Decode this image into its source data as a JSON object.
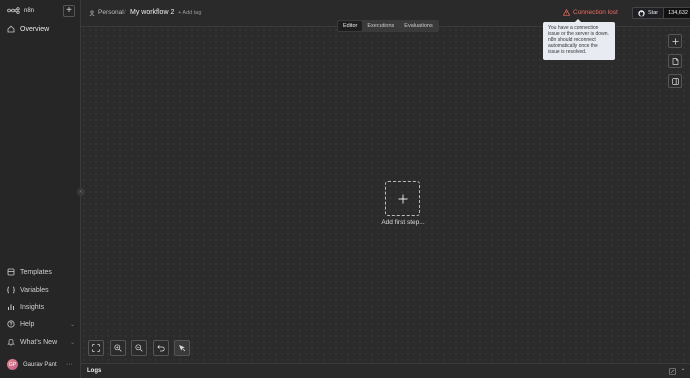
{
  "sidebar": {
    "logo_text": "n8n",
    "new_button": "+",
    "items": [
      {
        "label": "Overview",
        "icon": "home-icon"
      },
      {
        "label": "Templates",
        "icon": "templates-icon"
      },
      {
        "label": "Variables",
        "icon": "variables-icon"
      },
      {
        "label": "Insights",
        "icon": "insights-icon"
      },
      {
        "label": "Help",
        "icon": "help-icon"
      },
      {
        "label": "What's New",
        "icon": "bell-icon"
      }
    ],
    "user": {
      "initials": "GP",
      "name": "Gaurav Pant",
      "menu": "···"
    }
  },
  "header": {
    "project": "Personal",
    "separator": "/",
    "workflow_name": "My workflow 2",
    "add_tag": "+ Add tag",
    "connection_status": "Connection lost",
    "star_label": "Star",
    "star_count": "134,632"
  },
  "tabs": [
    {
      "label": "Editor",
      "selected": true
    },
    {
      "label": "Executions",
      "selected": false
    },
    {
      "label": "Evaluations",
      "selected": false
    }
  ],
  "tooltip": {
    "text": "You have a connection issue or the server is down. n8n should reconnect automatically once the issue is resolved."
  },
  "canvas": {
    "add_first_step": "Add first step..."
  },
  "logs": {
    "label": "Logs"
  },
  "colors": {
    "error": "#f06b5d",
    "background": "#2b2b2b",
    "sidebar": "#262626"
  }
}
